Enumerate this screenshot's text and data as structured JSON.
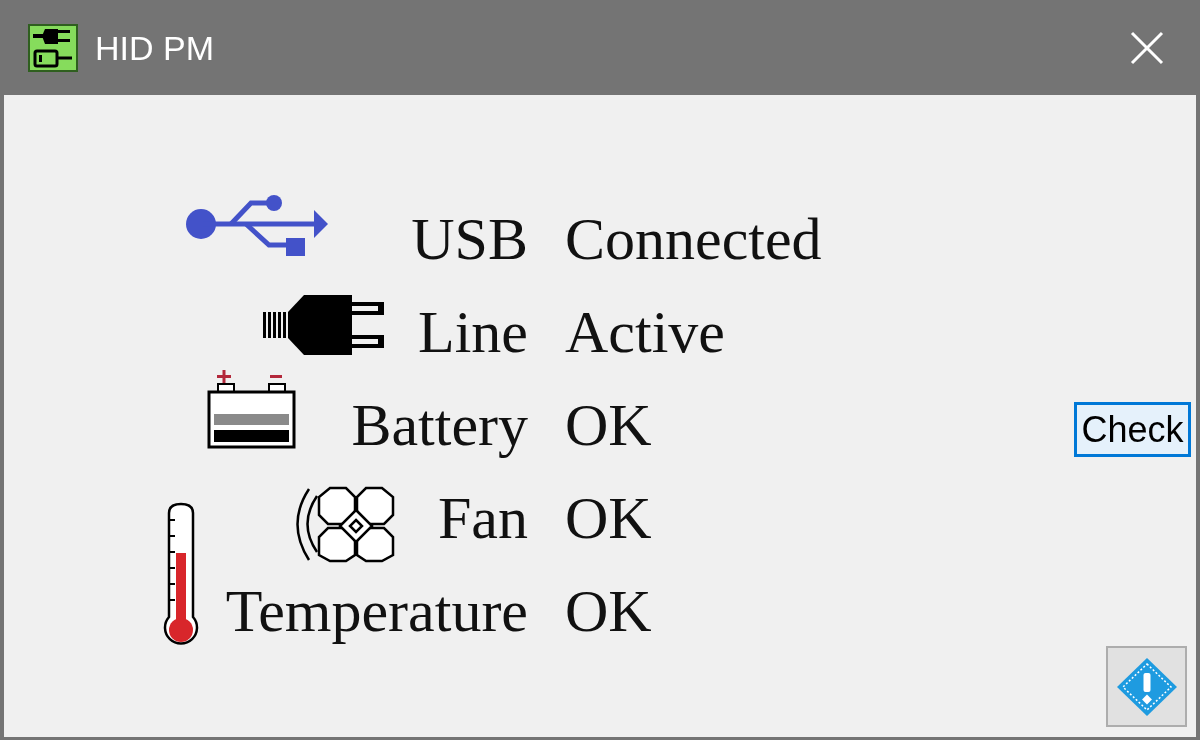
{
  "window": {
    "title": "HID PM"
  },
  "status_rows": [
    {
      "kind": "usb",
      "label": "USB",
      "value": "Connected"
    },
    {
      "kind": "line",
      "label": "Line",
      "value": "Active"
    },
    {
      "kind": "battery",
      "label": "Battery",
      "value": "OK"
    },
    {
      "kind": "fan",
      "label": "Fan",
      "value": "OK"
    },
    {
      "kind": "temperature",
      "label": "Temperature",
      "value": "OK"
    }
  ],
  "check_button": {
    "label": "Check",
    "focused": true
  }
}
